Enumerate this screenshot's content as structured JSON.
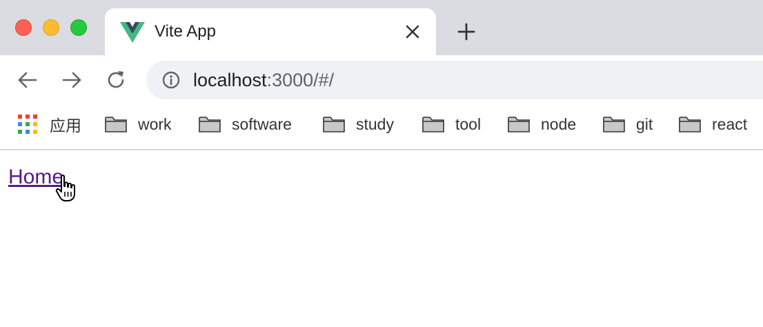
{
  "window": {
    "traffic_lights": {
      "close_color": "#fe5f57",
      "minimize_color": "#febc2e",
      "maximize_color": "#28c840"
    }
  },
  "tab": {
    "title": "Vite App",
    "favicon": "vue-logo-icon",
    "close_icon": "close-icon"
  },
  "new_tab_icon": "plus-icon",
  "toolbar": {
    "back_icon": "arrow-left-icon",
    "forward_icon": "arrow-right-icon",
    "reload_icon": "reload-icon",
    "site_info_icon": "info-icon",
    "url_host": "localhost",
    "url_rest": ":3000/#/"
  },
  "bookmarks": {
    "apps_label": "应用",
    "items": [
      {
        "label": "work",
        "icon": "folder-icon"
      },
      {
        "label": "software",
        "icon": "folder-icon"
      },
      {
        "label": "study",
        "icon": "folder-icon"
      },
      {
        "label": "tool",
        "icon": "folder-icon"
      },
      {
        "label": "node",
        "icon": "folder-icon"
      },
      {
        "label": "git",
        "icon": "folder-icon"
      },
      {
        "label": "react",
        "icon": "folder-icon"
      }
    ]
  },
  "page": {
    "home_link": "Home",
    "link_visited_color": "#551a8b",
    "cursor": "hand-pointer-icon"
  }
}
